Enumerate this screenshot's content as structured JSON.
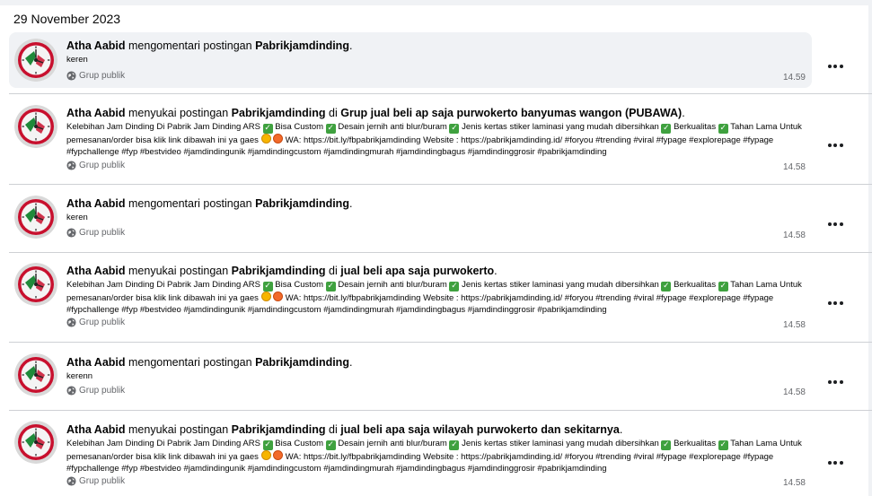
{
  "date_header": "29 November 2023",
  "entries": [
    {
      "actor": "Atha Aabid",
      "verb": "mengomentari postingan",
      "target": "Pabrikjamdinding",
      "suffix": ".",
      "body": "keren",
      "audience": "Grup publik",
      "time": "14.59",
      "highlighted": true
    },
    {
      "actor": "Atha Aabid",
      "verb": "menyukai postingan",
      "target": "Pabrikjamdinding",
      "joiner": "di",
      "group": "Grup jual beli ap saja purwokerto banyumas wangon (PUBAWA)",
      "suffix": ".",
      "body_parts": [
        "Kelebihan Jam Dinding Di Pabrik Jam Dinding ARS",
        "Bisa Custom",
        "Desain jernih anti blur/buram",
        "Jenis kertas stiker laminasi yang mudah dibersihkan",
        "Berkualitas",
        "Tahan Lama Untuk pemesanan/order bisa klik link dibawah ini ya gaes",
        "WA: https://bit.ly/fbpabrikjamdinding Website : https://pabrikjamdinding.id/ #foryou #trending #viral #fypage #explorepage #fypage #fypchallenge #fyp #bestvideo #jamdindingunik #jamdindingcustom #jamdindingmurah #jamdindingbagus #jamdindinggrosir #pabrikjamdinding"
      ],
      "audience": "Grup publik",
      "time": "14.58"
    },
    {
      "actor": "Atha Aabid",
      "verb": "mengomentari postingan",
      "target": "Pabrikjamdinding",
      "suffix": ".",
      "body": "keren",
      "audience": "Grup publik",
      "time": "14.58"
    },
    {
      "actor": "Atha Aabid",
      "verb": "menyukai postingan",
      "target": "Pabrikjamdinding",
      "joiner": "di",
      "group": "jual beli apa saja purwokerto",
      "suffix": ".",
      "body_parts": [
        "Kelebihan Jam Dinding Di Pabrik Jam Dinding ARS",
        "Bisa Custom",
        "Desain jernih anti blur/buram",
        "Jenis kertas stiker laminasi yang mudah dibersihkan",
        "Berkualitas",
        "Tahan Lama Untuk pemesanan/order bisa klik link dibawah ini ya gaes",
        "WA: https://bit.ly/fbpabrikjamdinding Website : https://pabrikjamdinding.id/ #foryou #trending #viral #fypage #explorepage #fypage #fypchallenge #fyp #bestvideo #jamdindingunik #jamdindingcustom #jamdindingmurah #jamdindingbagus #jamdindinggrosir #pabrikjamdinding"
      ],
      "audience": "Grup publik",
      "time": "14.58"
    },
    {
      "actor": "Atha Aabid",
      "verb": "mengomentari postingan",
      "target": "Pabrikjamdinding",
      "suffix": ".",
      "body": "kerenn",
      "audience": "Grup publik",
      "time": "14.58"
    },
    {
      "actor": "Atha Aabid",
      "verb": "menyukai postingan",
      "target": "Pabrikjamdinding",
      "joiner": "di",
      "group": "jual beli apa saja wilayah purwokerto dan sekitarnya",
      "suffix": ".",
      "body_parts": [
        "Kelebihan Jam Dinding Di Pabrik Jam Dinding ARS",
        "Bisa Custom",
        "Desain jernih anti blur/buram",
        "Jenis kertas stiker laminasi yang mudah dibersihkan",
        "Berkualitas",
        "Tahan Lama Untuk pemesanan/order bisa klik link dibawah ini ya gaes",
        "WA: https://bit.ly/fbpabrikjamdinding Website : https://pabrikjamdinding.id/ #foryou #trending #viral #fypage #explorepage #fypage #fypchallenge #fyp #bestvideo #jamdindingunik #jamdindingcustom #jamdindingmurah #jamdindingbagus #jamdindinggrosir #pabrikjamdinding"
      ],
      "audience": "Grup publik",
      "time": "14.58"
    }
  ],
  "icons": {
    "more": "more-options-icon",
    "audience": "globe-icon",
    "check": "check-mark-emoji",
    "laugh": "smiling-emoji",
    "heart_eyes": "heart-eyes-emoji"
  },
  "colors": {
    "highlight": "#f0f2f5",
    "meta_text": "#65676b",
    "divider": "#ced0d4",
    "check_green": "#3fa13f"
  }
}
